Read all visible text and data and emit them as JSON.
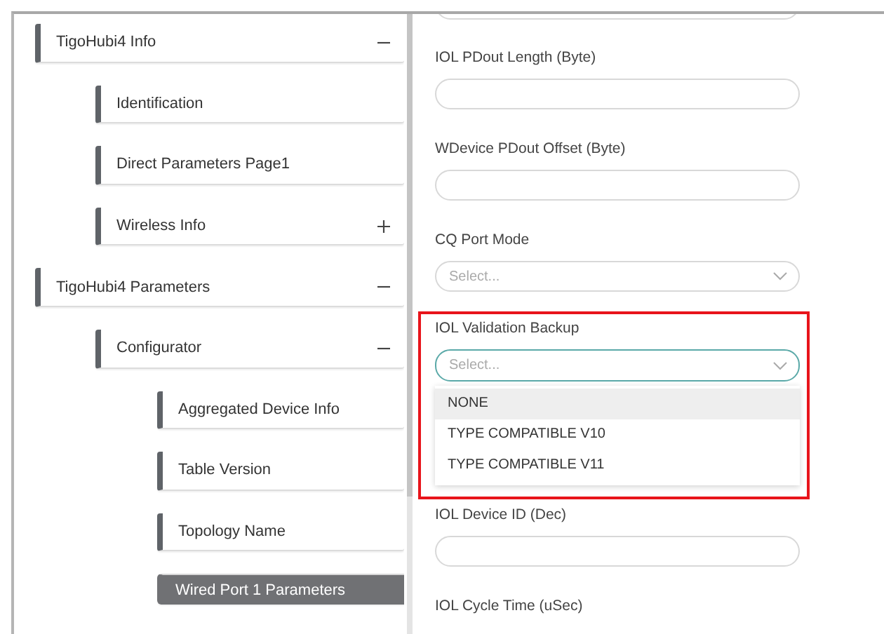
{
  "tree": [
    {
      "label": "TigoHubi4 Info",
      "expanded": true,
      "selected": false,
      "children": [
        {
          "label": "Identification",
          "selected": false
        },
        {
          "label": "Direct Parameters Page1",
          "selected": false
        },
        {
          "label": "Wireless Info",
          "expanded": false,
          "selected": false
        }
      ]
    },
    {
      "label": "TigoHubi4 Parameters",
      "expanded": true,
      "selected": false,
      "children": [
        {
          "label": "Configurator",
          "expanded": true,
          "selected": false,
          "children": [
            {
              "label": "Aggregated Device Info",
              "selected": false
            },
            {
              "label": "Table Version",
              "selected": false
            },
            {
              "label": "Topology Name",
              "selected": false
            },
            {
              "label": "Wired Port 1 Parameters",
              "selected": true
            }
          ]
        }
      ]
    }
  ],
  "form": [
    {
      "kind": "input"
    },
    {
      "kind": "input",
      "label": "IOL PDout Length (Byte)"
    },
    {
      "kind": "input",
      "label": "WDevice PDout Offset (Byte)"
    },
    {
      "kind": "select",
      "label": "CQ Port Mode",
      "placeholder": "Select...",
      "open": false
    },
    {
      "kind": "select",
      "label": "IOL Validation Backup",
      "placeholder": "Select...",
      "open": true,
      "highlighted": true,
      "options": [
        {
          "label": "NONE",
          "hovered": true
        },
        {
          "label": "TYPE COMPATIBLE V10",
          "hovered": false
        },
        {
          "label": "TYPE COMPATIBLE V11",
          "hovered": false
        }
      ]
    },
    {
      "kind": "input",
      "label": "IOL Device ID (Dec)"
    },
    {
      "label": "IOL Cycle Time (uSec)"
    }
  ]
}
